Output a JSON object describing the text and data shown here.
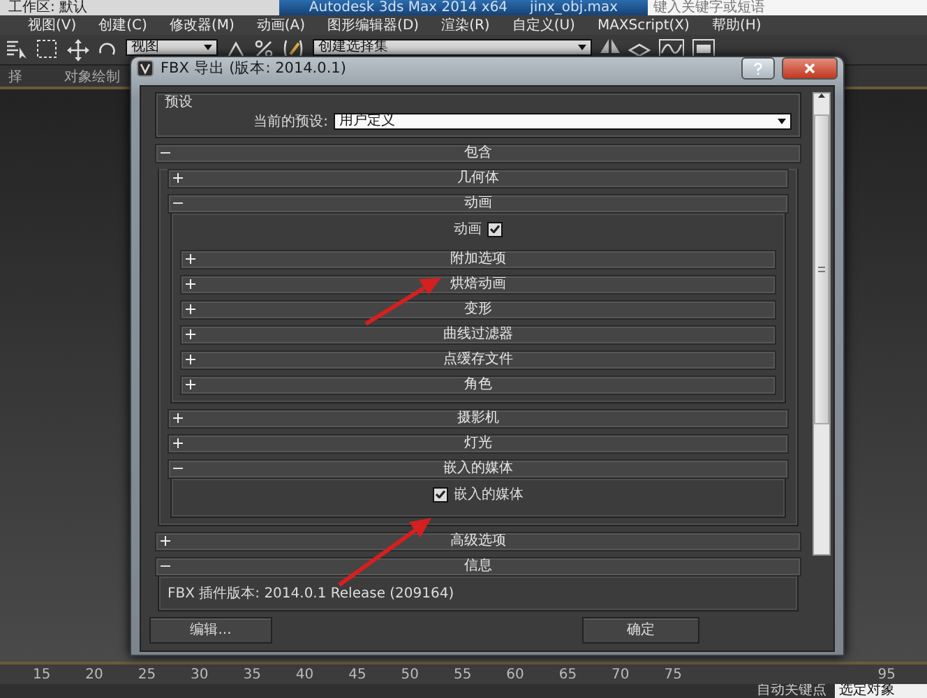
{
  "app": {
    "workspace": "工作区: 默认",
    "title": "Autodesk 3ds Max 2014 x64",
    "file": "jinx_obj.max",
    "search_placeholder": "键入关键字或短语"
  },
  "menu": [
    "视图(V)",
    "创建(C)",
    "修改器(M)",
    "动画(A)",
    "图形编辑器(D)",
    "渲染(R)",
    "自定义(U)",
    "MAXScript(X)",
    "帮助(H)"
  ],
  "toolbar": {
    "view_dropdown": "视图",
    "selection_set": "创建选择集"
  },
  "ribbon_labels": [
    "择",
    "对象绘制"
  ],
  "dialog": {
    "title": "FBX 导出 (版本: 2014.0.1)",
    "presets": {
      "group": "预设",
      "label": "当前的预设:",
      "value": "用户定义"
    },
    "rollouts": [
      {
        "label": "包含",
        "expanded": true,
        "children": [
          {
            "label": "几何体",
            "expanded": false
          },
          {
            "label": "动画",
            "expanded": true,
            "checkbox": {
              "label": "动画",
              "checked": true,
              "kind": "label-left"
            },
            "children": [
              {
                "label": "附加选项",
                "expanded": false
              },
              {
                "label": "烘焙动画",
                "expanded": false
              },
              {
                "label": "变形",
                "expanded": false
              },
              {
                "label": "曲线过滤器",
                "expanded": false
              },
              {
                "label": "点缓存文件",
                "expanded": false
              },
              {
                "label": "角色",
                "expanded": false
              }
            ]
          },
          {
            "label": "摄影机",
            "expanded": false
          },
          {
            "label": "灯光",
            "expanded": false
          },
          {
            "label": "嵌入的媒体",
            "expanded": true,
            "checkbox": {
              "label": "嵌入的媒体",
              "checked": true,
              "kind": "label-right"
            }
          }
        ]
      },
      {
        "label": "高级选项",
        "expanded": false
      },
      {
        "label": "信息",
        "expanded": true,
        "text": "FBX 插件版本: 2014.0.1 Release (209164)"
      }
    ],
    "buttons": [
      "编辑...",
      "确定"
    ]
  },
  "timeline": {
    "ticks": [
      "15",
      "20",
      "25",
      "30",
      "35",
      "40",
      "45",
      "50",
      "55",
      "60",
      "65",
      "70",
      "75",
      "95"
    ]
  },
  "status": {
    "auto_key": "自动关键点",
    "selection": "选定对象"
  }
}
